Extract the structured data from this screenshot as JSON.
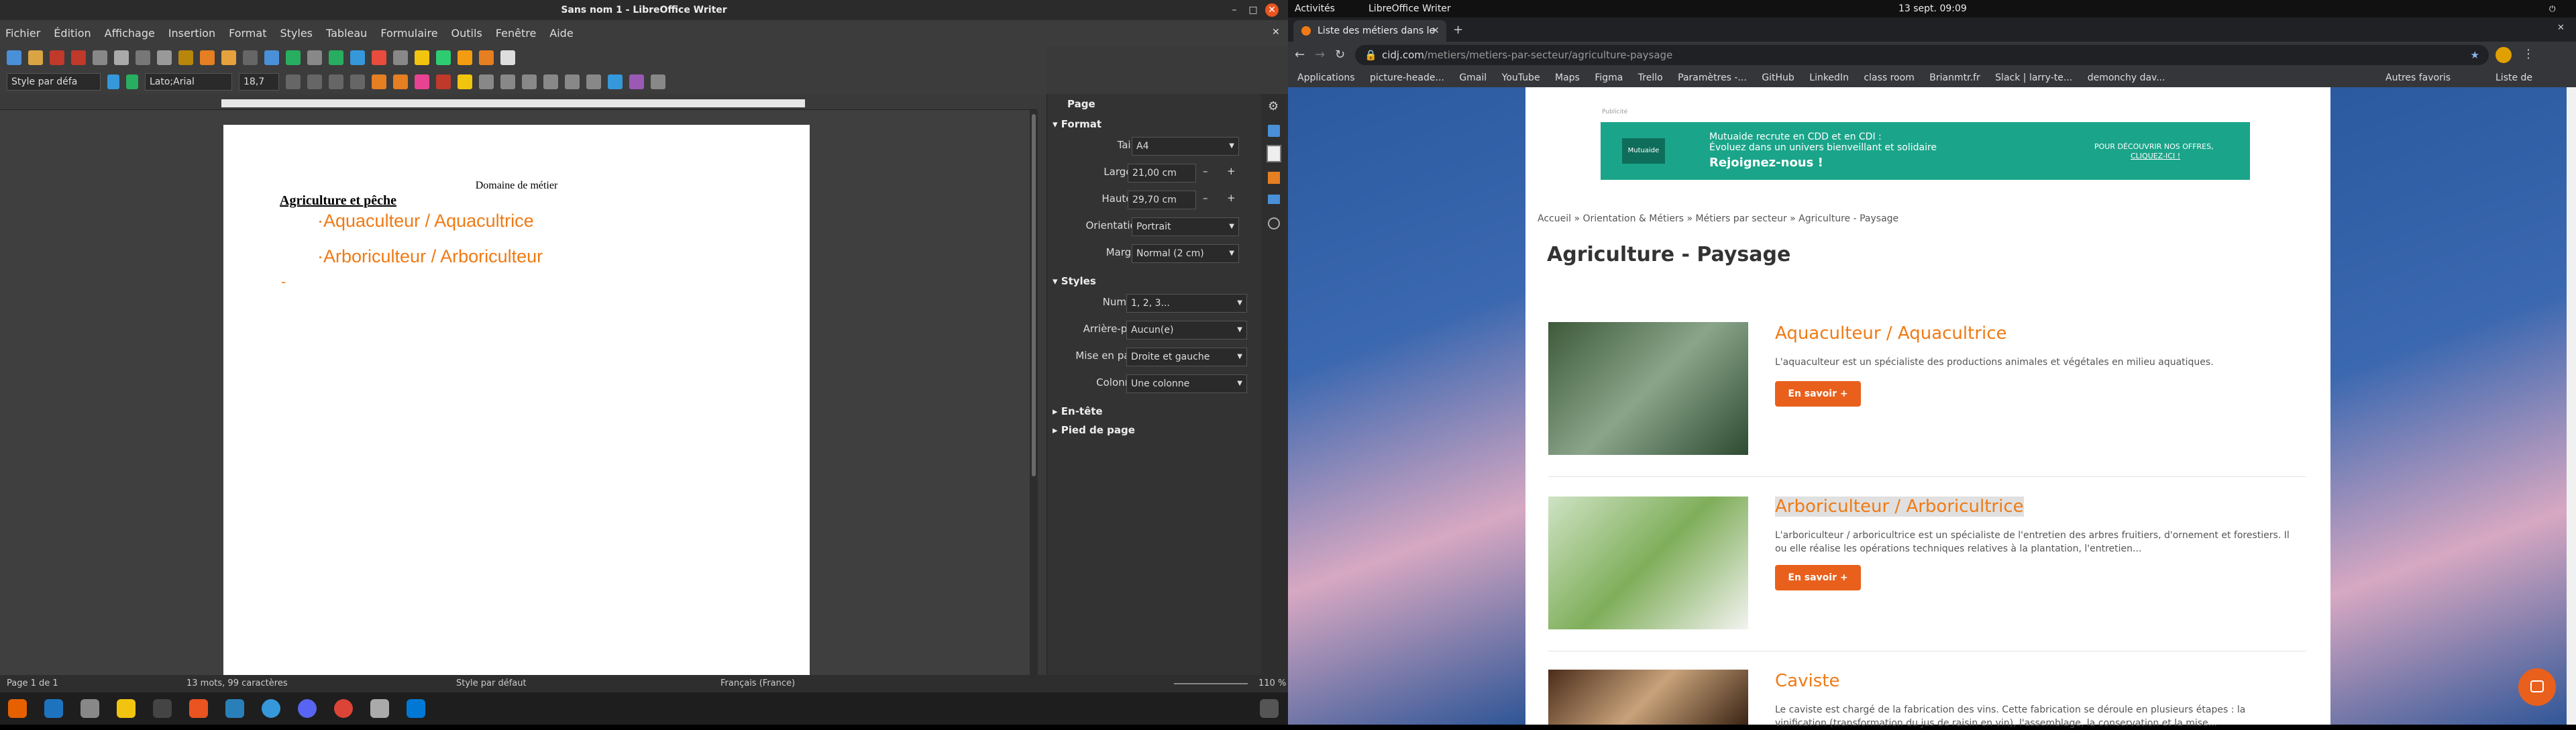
{
  "lo": {
    "title": "Sans nom 1 - LibreOffice Writer",
    "menu": [
      "Fichier",
      "Édition",
      "Affichage",
      "Insertion",
      "Format",
      "Styles",
      "Tableau",
      "Formulaire",
      "Outils",
      "Fenêtre",
      "Aide"
    ],
    "para_style": "Style par défa",
    "font_name": "Lato;Arial",
    "font_size": "18,7",
    "doc": {
      "header": "Domaine de métier",
      "heading": "Agriculture et pêche",
      "item1": "Aquaculteur / Aquacultrice",
      "item2": "Arboriculteur / Arboriculteur"
    },
    "sidebar": {
      "title": "Page",
      "format_head": "Format",
      "taille_label": "Taille :",
      "taille": "A4",
      "largeur_label": "Largeur :",
      "largeur": "21,00 cm",
      "hauteur_label": "Hauteur :",
      "hauteur": "29,70 cm",
      "orientation_label": "Orientation :",
      "orientation": "Portrait",
      "marges_label": "Marges :",
      "marges": "Normal (2 cm)",
      "styles_head": "Styles",
      "numero_label": "Numéro :",
      "numero": "1, 2, 3...",
      "arriere_label": "Arrière-plan :",
      "arriere": "Aucun(e)",
      "mise_label": "Mise en page :",
      "mise": "Droite et gauche",
      "colonnes_label": "Colonnes :",
      "colonnes": "Une colonne",
      "entete_head": "En-tête",
      "pied_head": "Pied de page"
    },
    "status": {
      "page": "Page 1 de 1",
      "words": "13 mots, 99 caractères",
      "style": "Style par défaut",
      "lang": "Français (France)",
      "zoom": "110 %"
    }
  },
  "gnome": {
    "activities": "Activités",
    "app": "LibreOffice Writer",
    "clock": "13 sept.  09:09"
  },
  "chrome": {
    "tab_title": "Liste des métiers dans le",
    "url_host": "cidj.com",
    "url_path": "/metiers/metiers-par-secteur/agriculture-paysage",
    "bookmarks": [
      "Applications",
      "picture-heade...",
      "Gmail",
      "YouTube",
      "Maps",
      "Figma",
      "Trello",
      "Paramètres -...",
      "GitHub",
      "LinkedIn",
      "class room",
      "Brianmtr.fr",
      "Slack | larry-te...",
      "demonchy dav..."
    ],
    "bookmarks_right": [
      "Autres favoris",
      "Liste de lecture"
    ]
  },
  "web": {
    "pub": "Publicité",
    "ad_brand": "Mutuaide",
    "ad_line1": "Mutuaide recrute en CDD et en CDI :",
    "ad_line2": "Évoluez dans un univers bienveillant et solidaire",
    "ad_line3": "Rejoignez-nous !",
    "ad_cta1": "POUR DÉCOUVRIR NOS OFFRES,",
    "ad_cta2": "CLIQUEZ-ICI !",
    "breadcrumb": "Accueil » Orientation & Métiers » Métiers par secteur » Agriculture - Paysage",
    "page_title": "Agriculture - Paysage",
    "jobs": [
      {
        "title": "Aquaculteur / Aquacultrice",
        "desc": "L'aquaculteur est un spécialiste des productions animales et végétales en milieu aquatiques.",
        "btn": "En savoir +"
      },
      {
        "title": "Arboriculteur / Arboricultrice",
        "desc": "L'arboriculteur / arboricultrice est un spécialiste de l'entretien des arbres fruitiers, d'ornement et forestiers. Il ou elle réalise les opérations techniques relatives à la plantation, l'entretien...",
        "btn": "En savoir +"
      },
      {
        "title": "Caviste",
        "desc": "Le caviste est chargé de la fabrication des vins. Cette fabrication se déroule en plusieurs étapes : la vinification (transformation du jus de raisin en vin), l'assemblage, la conservation et la mise..."
      }
    ]
  },
  "colors": {
    "accent": "#f07a14",
    "btn": "#e8601c",
    "ad": "#1aa58a"
  }
}
